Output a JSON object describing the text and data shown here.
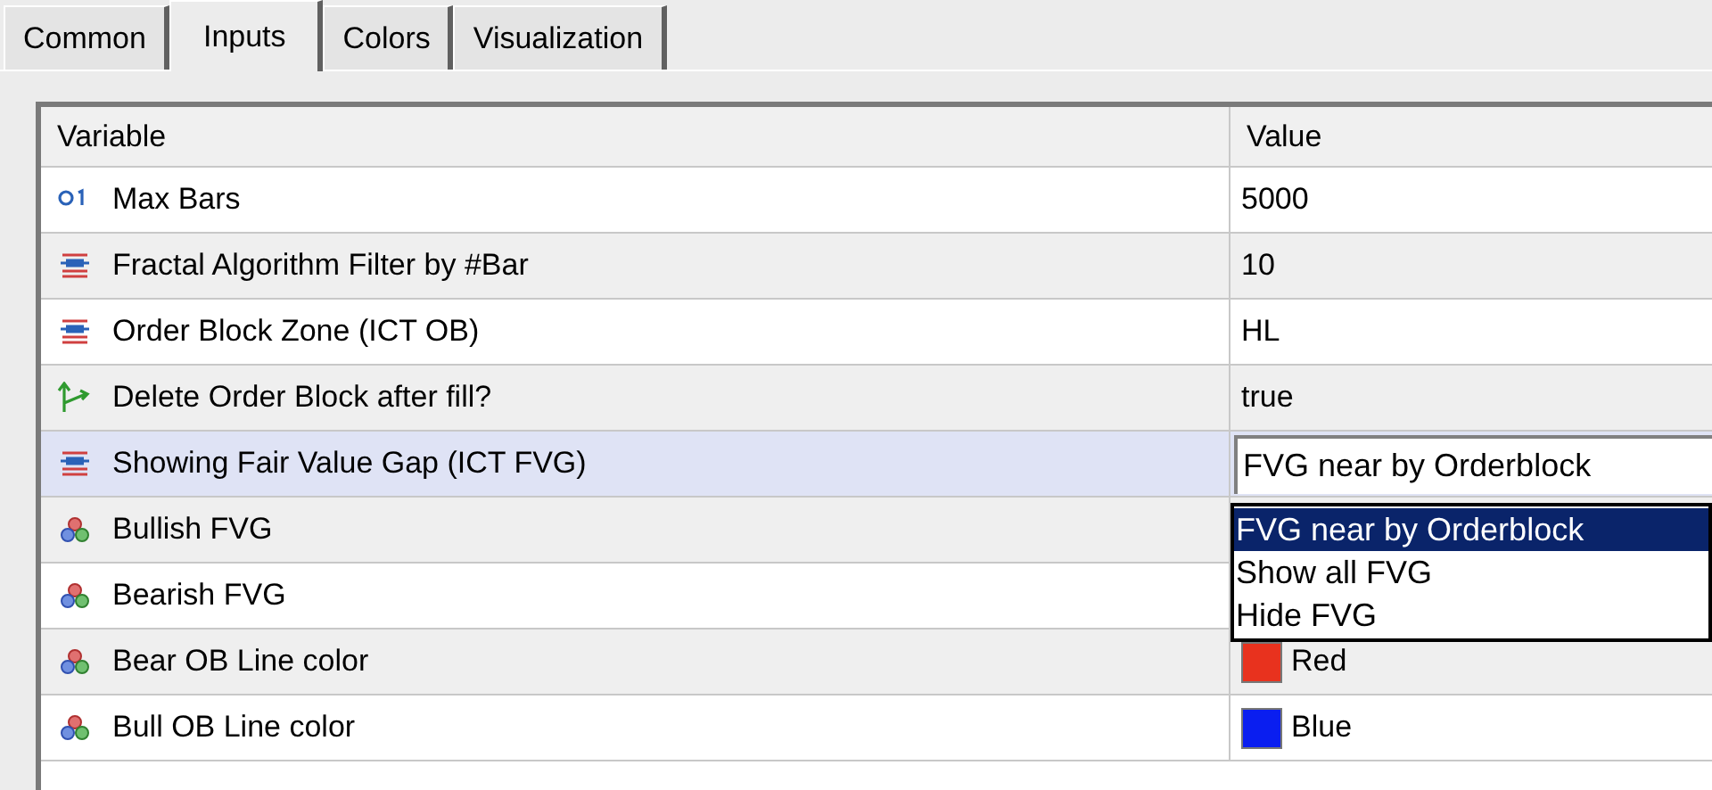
{
  "tabs": [
    {
      "label": "Common",
      "selected": false
    },
    {
      "label": "Inputs",
      "selected": true
    },
    {
      "label": "Colors",
      "selected": false
    },
    {
      "label": "Visualization",
      "selected": false
    }
  ],
  "table": {
    "columns": [
      "Variable",
      "Value"
    ],
    "rows": [
      {
        "kind": "number",
        "name": "Max Bars",
        "value": "5000",
        "selected": false
      },
      {
        "kind": "enum",
        "name": "Fractal Algorithm Filter by #Bar",
        "value": "10",
        "selected": false
      },
      {
        "kind": "enum",
        "name": "Order Block Zone (ICT OB)",
        "value": "HL",
        "selected": false
      },
      {
        "kind": "bool",
        "name": "Delete Order Block after fill?",
        "value": "true",
        "selected": false
      },
      {
        "kind": "enum",
        "name": "Showing Fair Value Gap (ICT FVG)",
        "value": "FVG near by Orderblock",
        "selected": true,
        "editing": true
      },
      {
        "kind": "color",
        "name": "Bullish FVG",
        "selected": false
      },
      {
        "kind": "color",
        "name": "Bearish FVG",
        "selected": false
      },
      {
        "kind": "color",
        "name": "Bear OB Line color",
        "value": "Red",
        "color": "#e8321e",
        "selected": false
      },
      {
        "kind": "color",
        "name": "Bull OB Line color",
        "value": "Blue",
        "color": "#0a1ef0",
        "selected": false
      }
    ]
  },
  "dropdown": {
    "options": [
      {
        "label": "FVG near by Orderblock",
        "selected": true
      },
      {
        "label": "Show all FVG",
        "selected": false
      },
      {
        "label": "Hide FVG",
        "selected": false
      }
    ]
  }
}
